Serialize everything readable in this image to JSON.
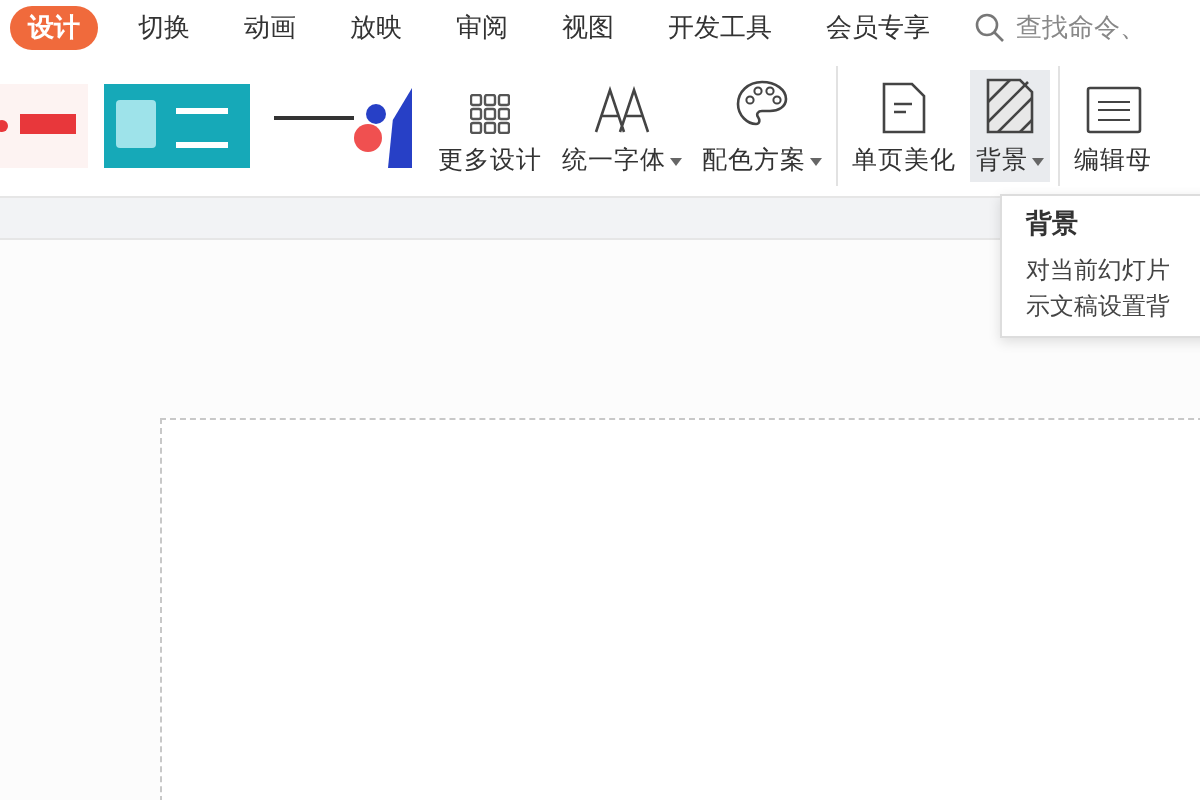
{
  "tabs": [
    {
      "label": "设计",
      "selected": true
    },
    {
      "label": "切换",
      "selected": false
    },
    {
      "label": "动画",
      "selected": false
    },
    {
      "label": "放映",
      "selected": false
    },
    {
      "label": "审阅",
      "selected": false
    },
    {
      "label": "视图",
      "selected": false
    },
    {
      "label": "开发工具",
      "selected": false
    },
    {
      "label": "会员专享",
      "selected": false
    }
  ],
  "search": {
    "placeholder": "查找命令、"
  },
  "ribbon": {
    "groups": [
      [
        {
          "kind": "grid",
          "label": "更多设计",
          "dropdown": false,
          "hovered": false
        },
        {
          "kind": "font",
          "label": "统一字体",
          "dropdown": true,
          "hovered": false
        },
        {
          "kind": "palette",
          "label": "配色方案",
          "dropdown": true,
          "hovered": false
        }
      ],
      [
        {
          "kind": "page",
          "label": "单页美化",
          "dropdown": false,
          "hovered": false
        },
        {
          "kind": "background",
          "label": "背景",
          "dropdown": true,
          "hovered": true
        }
      ],
      [
        {
          "kind": "master",
          "label": "编辑母",
          "dropdown": false,
          "hovered": false
        }
      ]
    ]
  },
  "tooltip": {
    "title": "背景",
    "lines": [
      "对当前幻灯片",
      "示文稿设置背"
    ]
  }
}
